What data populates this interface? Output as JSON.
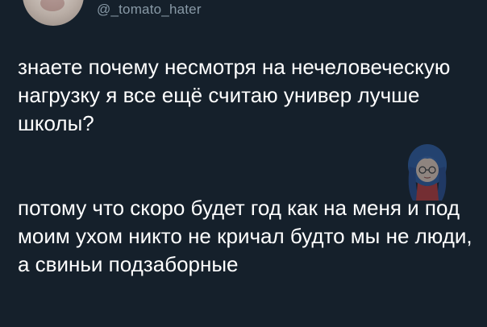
{
  "tweet": {
    "handle": "@_tomato_hater",
    "paragraph1": "знаете почему несмотря на нечеловеческую нагрузку я все ещё считаю универ лучше школы?",
    "paragraph2": "потому что скоро будет год как на меня и под моим ухом никто не кричал будто мы не люди, а свиньи подзаборные"
  },
  "colors": {
    "background": "#15202b",
    "text": "#ffffff",
    "handle": "#8899a6"
  },
  "icons": {
    "avatar": "user-avatar",
    "watermark": "anime-girl-watermark"
  }
}
